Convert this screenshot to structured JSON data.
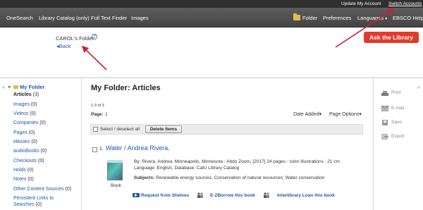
{
  "utility": {
    "update_account": "Update My Account",
    "switch_accounts": "Switch Accounts"
  },
  "nav": {
    "onesearch": "OneSearch",
    "catalog": "Library Catalog (only)",
    "fulltext": "Full Text Finder",
    "images": "Images",
    "folder": "Folder",
    "preferences": "Preferences",
    "languages": "Languages",
    "help": "EBSCO Help"
  },
  "header": {
    "folder_title": "CAROL's Folder",
    "help_mark": "?",
    "back": "Back",
    "ask": "Ask the Library"
  },
  "sidebar": {
    "folder_label": "My Folder",
    "items": [
      {
        "label": "Articles",
        "count": "(3)"
      },
      {
        "label": "Images",
        "count": "(0)"
      },
      {
        "label": "Videos",
        "count": "(0)"
      },
      {
        "label": "Companies",
        "count": "(0)"
      },
      {
        "label": "Pages",
        "count": "(0)"
      },
      {
        "label": "eBooks",
        "count": "(0)"
      },
      {
        "label": "audioBooks",
        "count": "(0)"
      },
      {
        "label": "Checkouts",
        "count": "(0)"
      },
      {
        "label": "Holds",
        "count": "(0)"
      },
      {
        "label": "Notes",
        "count": "(0)"
      },
      {
        "label": "Other Content Sources",
        "count": "(0)"
      },
      {
        "label": "Persistent Links to",
        "count": ""
      },
      {
        "label": "Searches",
        "count": "(0)"
      }
    ]
  },
  "main": {
    "title": "My Folder: Articles",
    "count": "1-3 of 3",
    "page_label": "Page:",
    "page_num": "1",
    "sort": "Date Added",
    "options": "Page Options",
    "select_all": "Select / deselect all",
    "delete": "Delete Items"
  },
  "record": {
    "num": "1.",
    "title": "Water / Andrea Rivera.",
    "type": "Book",
    "line1": "By: Rivera, Andrea. Minneapolis, Minnesota : Abdo Zoom, [2017] 24 pages : color illustrations ; 21 cm",
    "line2": "Language: English, Database: CalU Library Catalog",
    "subjects_label": "Subjects:",
    "subjects": "Renewable energy sources; Conservation of natural resources; Water conservation",
    "actions": [
      "Request from Shelves",
      "E-ZBorrow this book",
      "Interlibrary Loan this book"
    ]
  },
  "tools": [
    "Print",
    "E-mail",
    "Save",
    "Export"
  ],
  "colors": {
    "ask_button": "#e23a2b",
    "link": "#1f5aa6",
    "arrow": "#d0202c"
  }
}
